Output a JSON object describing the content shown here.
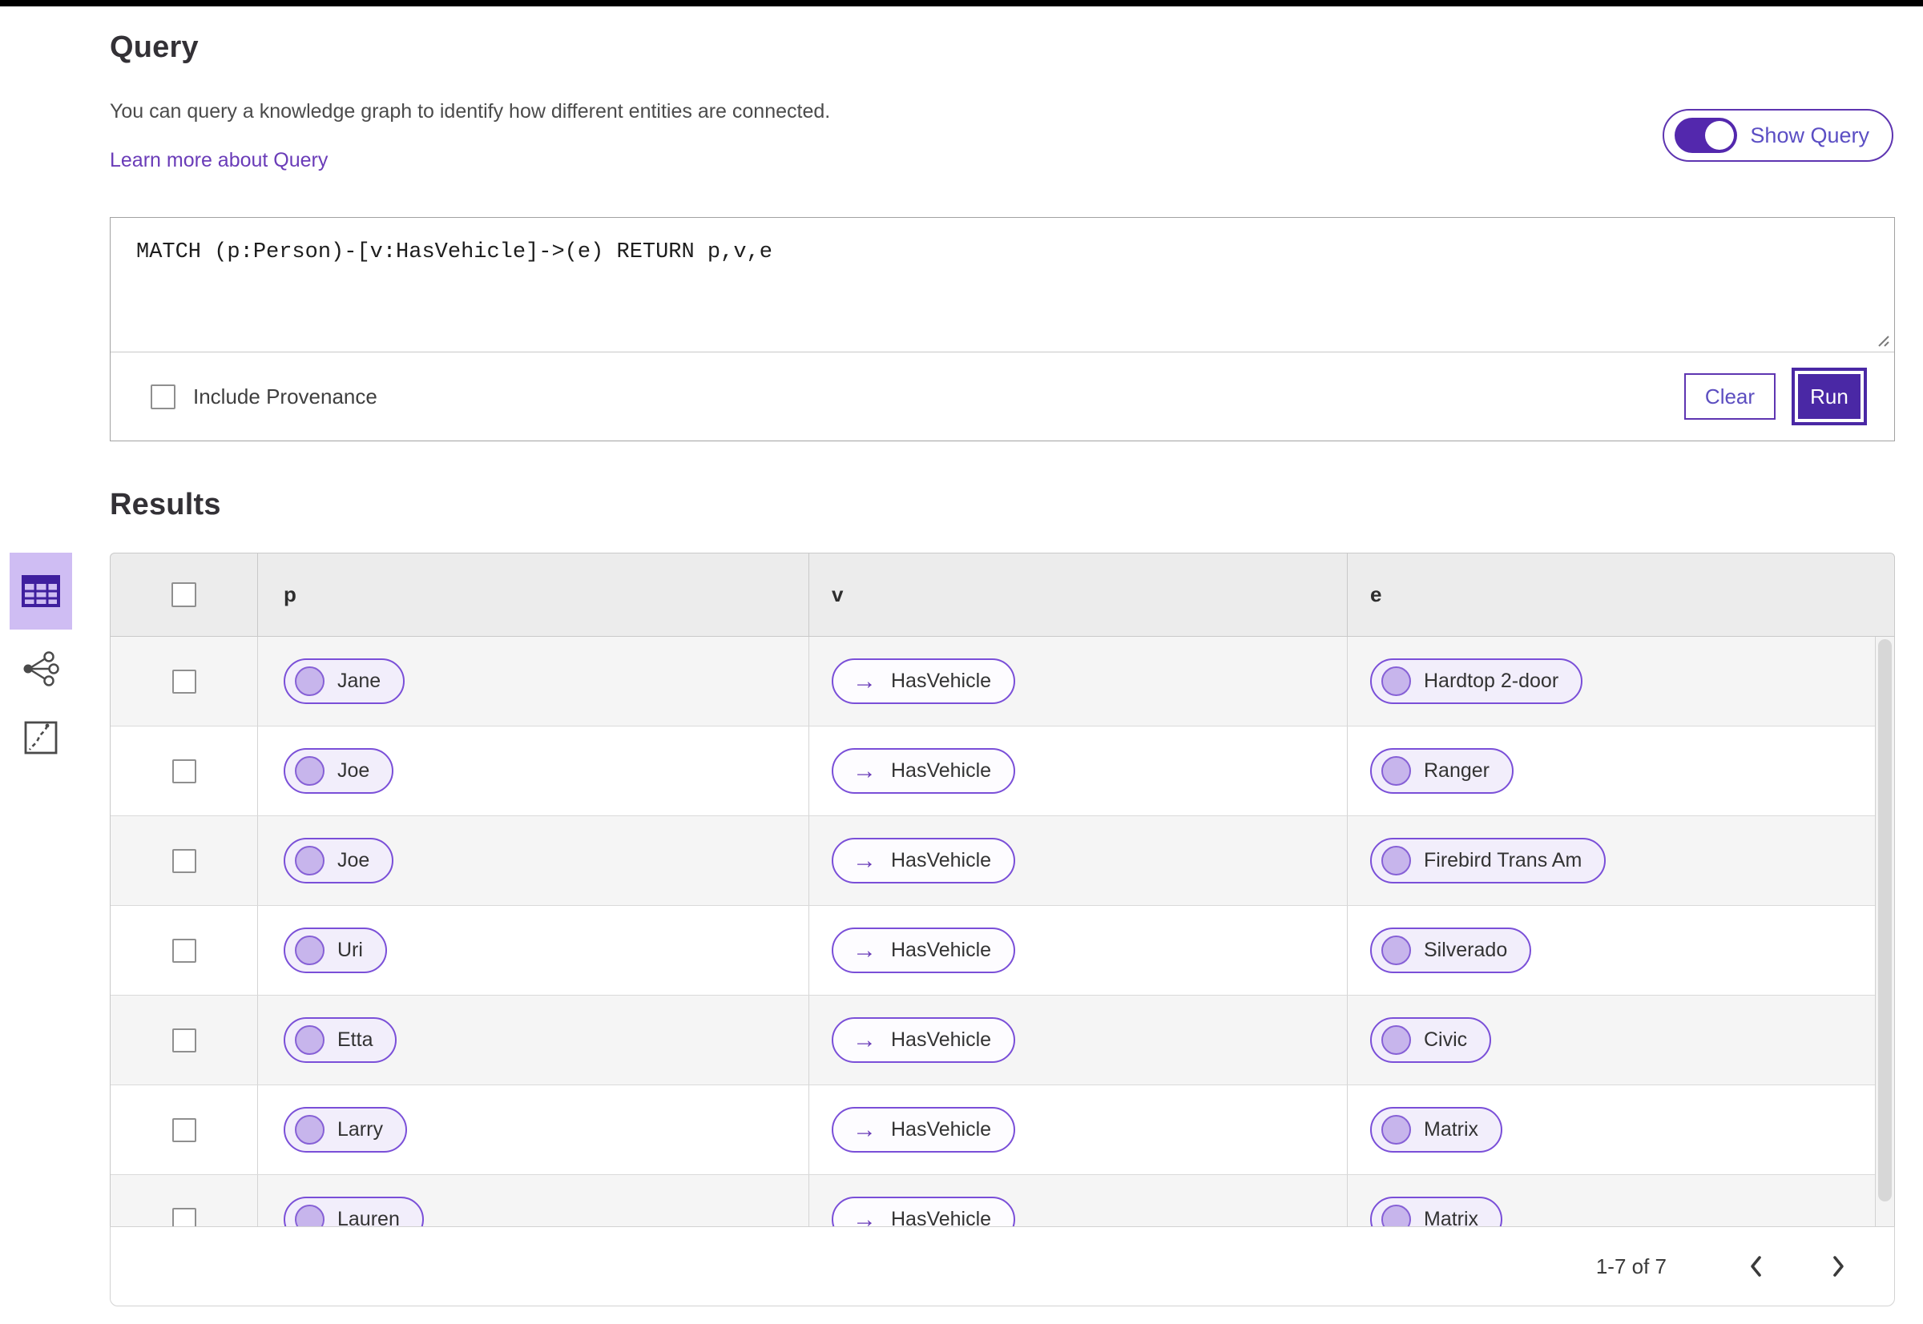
{
  "colors": {
    "primary": "#4a28a5",
    "primary_border": "#5e35b1",
    "pill_border": "#7a4fd8",
    "pill_background": "#f2eefb",
    "pill_circle": "#c7b5ec",
    "link": "#6a3cb8",
    "selected_view_background": "#cfbdf3",
    "table_header_background": "#ececec",
    "alt_row_background": "#f5f5f5"
  },
  "query_section": {
    "title": "Query",
    "description": "You can query a knowledge graph to identify how different entities are connected.",
    "learn_more_link": "Learn more about Query",
    "show_query_toggle": {
      "label": "Show Query",
      "state": "on"
    },
    "editor": {
      "query_text": "MATCH (p:Person)-[v:HasVehicle]->(e) RETURN p,v,e",
      "include_provenance_label": "Include Provenance",
      "include_provenance_checked": false,
      "clear_button": "Clear",
      "run_button": "Run"
    }
  },
  "results_section": {
    "title": "Results",
    "view_rail": {
      "items": [
        {
          "icon": "table-view-icon",
          "selected": true
        },
        {
          "icon": "graph-view-icon",
          "selected": false
        },
        {
          "icon": "map-view-icon",
          "selected": false
        }
      ]
    },
    "table": {
      "columns": [
        "p",
        "v",
        "e"
      ],
      "edge_arrow": "→",
      "rows": [
        {
          "p": "Jane",
          "v": "HasVehicle",
          "e": "Hardtop 2-door"
        },
        {
          "p": "Joe",
          "v": "HasVehicle",
          "e": "Ranger"
        },
        {
          "p": "Joe",
          "v": "HasVehicle",
          "e": "Firebird Trans Am"
        },
        {
          "p": "Uri",
          "v": "HasVehicle",
          "e": "Silverado"
        },
        {
          "p": "Etta",
          "v": "HasVehicle",
          "e": "Civic"
        },
        {
          "p": "Larry",
          "v": "HasVehicle",
          "e": "Matrix"
        },
        {
          "p": "Lauren",
          "v": "HasVehicle",
          "e": "Matrix"
        }
      ]
    },
    "pagination": {
      "range_label": "1-7 of 7",
      "prev_icon": "chevron-left-icon",
      "next_icon": "chevron-right-icon"
    }
  }
}
